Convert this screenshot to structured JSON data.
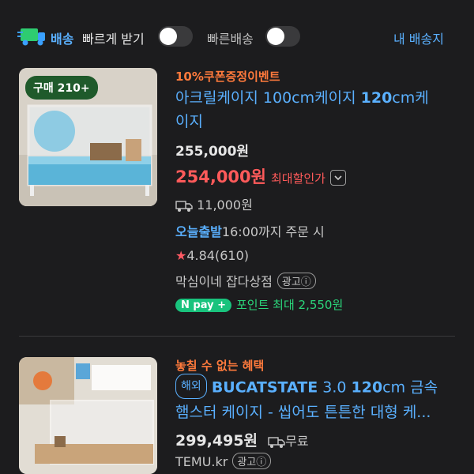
{
  "topbar": {
    "delivery_label": "배송",
    "fast_label": "빠르게 받기",
    "rocket_label": "빠른배송",
    "my_delivery": "내 배송지"
  },
  "product1": {
    "badge": "구매 210+",
    "event": "10%쿠폰증정이벤트",
    "title_line1": "아크릴케이지 100cm케이지 ",
    "title_bold": "120",
    "title_line1b": "cm케",
    "title_line2": "이지",
    "orig_price": "255,000원",
    "sale_price": "254,000원",
    "max_discount": "최대할인가",
    "shipping": "11,000원",
    "today_label": "오늘출발",
    "today_detail": "16:00까지 주문 시",
    "rating": "4.84",
    "reviews": "(610)",
    "seller": "막심이네 잡다상점",
    "ad_label": "광고ⓘ",
    "npay_label": "pay",
    "points": "포인트 최대 2,550원"
  },
  "product2": {
    "event": "놓칠 수 없는 혜택",
    "overseas": "해외",
    "title_a": "BUCATSTATE",
    "title_b": " 3.0 ",
    "title_c": "120",
    "title_d": "cm 금속",
    "title_line2": "햄스터 케이지 - 씹어도 튼튼한 대형 케...",
    "price": "299,495원",
    "free_ship": "무료",
    "seller": "TEMU.kr",
    "ad_label": "광고ⓘ"
  },
  "colors": {
    "accent": "#5ab0ff",
    "sale": "#ff5a5a",
    "event": "#ff7a3c",
    "point": "#2bd47a"
  }
}
